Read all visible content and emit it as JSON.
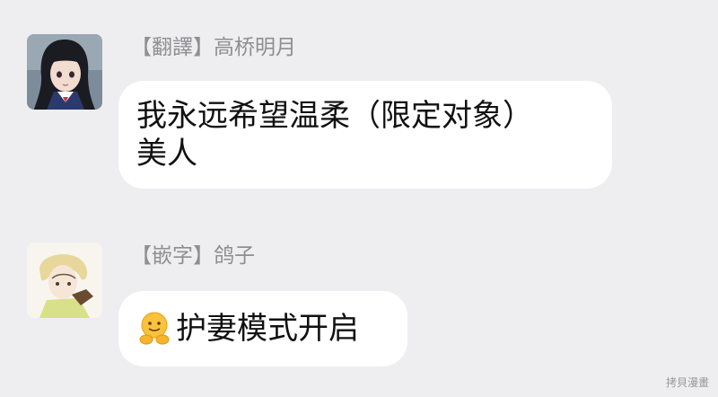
{
  "messages": [
    {
      "sender": "【翻譯】高桥明月",
      "avatar": "anime-girl-avatar",
      "text_lines": [
        "我永远希望温柔（限定对象）",
        "美人"
      ]
    },
    {
      "sender": "【嵌字】鸽子",
      "avatar": "anime-boy-avatar",
      "emoji": "hugging-face-emoji",
      "text": "护妻模式开启"
    }
  ],
  "watermark": "拷貝漫畫",
  "colors": {
    "background": "#eeeef0",
    "bubble": "#ffffff",
    "sender_text": "#8e8e93",
    "message_text": "#111111"
  }
}
